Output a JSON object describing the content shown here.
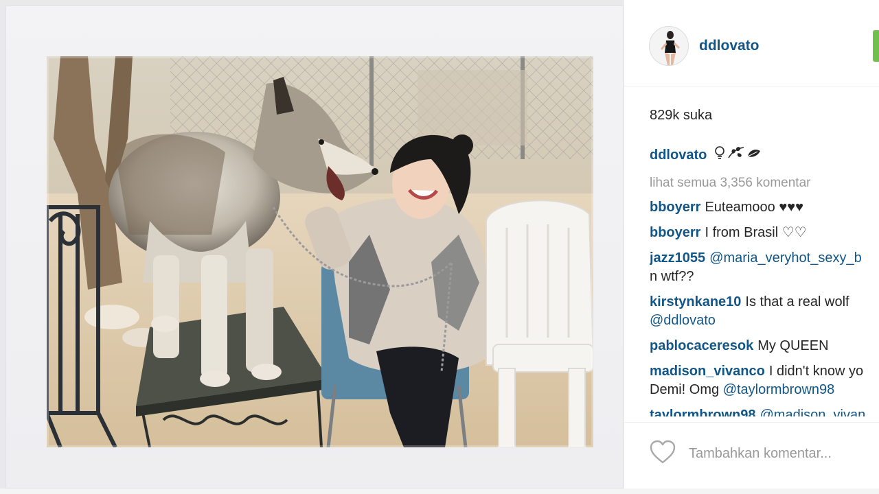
{
  "post": {
    "username": "ddlovato",
    "follow_color": "#70c050",
    "likes": "829k suka",
    "caption": {
      "username": "ddlovato",
      "icons": [
        "lightbulb-icon",
        "leaf-vine-icon",
        "leaf-icon"
      ]
    },
    "view_all": "lihat semua 3,356 komentar",
    "comments": [
      {
        "user": "bboyerr",
        "text": "Euteamooo ♥♥♥"
      },
      {
        "user": "bboyerr",
        "text": "I from Brasil ♡♡"
      },
      {
        "user": "jazz1055",
        "mention": "@maria_veryhot_sexy_b",
        "text": "n wtf??"
      },
      {
        "user": "kirstynkane10",
        "text": "Is that a real wolf",
        "mention": "@ddlovato"
      },
      {
        "user": "pablocaceresok",
        "text": "My QUEEN"
      },
      {
        "user": "madison_vivanco",
        "text": "I didn't know yo",
        "text2": "Demi! Omg",
        "mention": "@taylormbrown98"
      },
      {
        "user": "taylormbrown98",
        "text": "@madison_vivan"
      }
    ],
    "comment_placeholder": "Tambahkan komentar..."
  },
  "colors": {
    "link": "#125688",
    "text": "#262626",
    "muted": "#999999"
  }
}
